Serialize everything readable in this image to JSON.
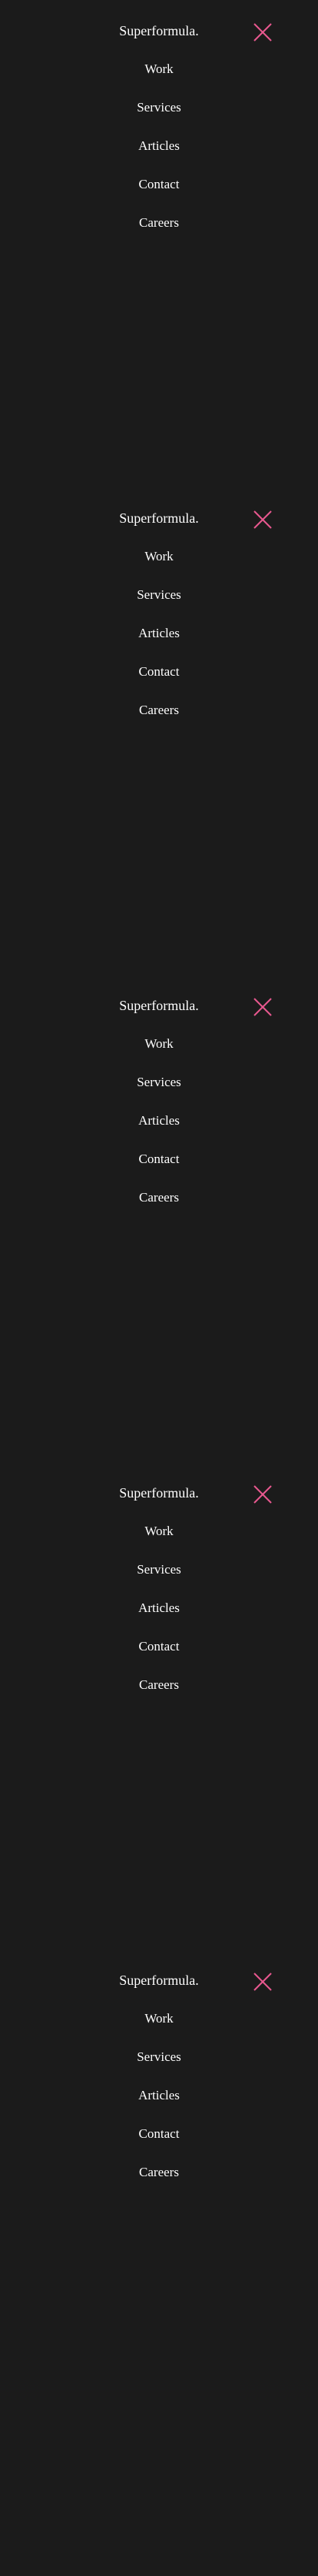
{
  "theme": {
    "background": "#1b1b1b",
    "text": "#ffffff",
    "accent": "#e8588f"
  },
  "menu": {
    "brand": "Superformula.",
    "close_icon": "close-x-icon",
    "items": [
      {
        "label": "Work"
      },
      {
        "label": "Services"
      },
      {
        "label": "Articles"
      },
      {
        "label": "Contact"
      },
      {
        "label": "Careers"
      }
    ]
  }
}
